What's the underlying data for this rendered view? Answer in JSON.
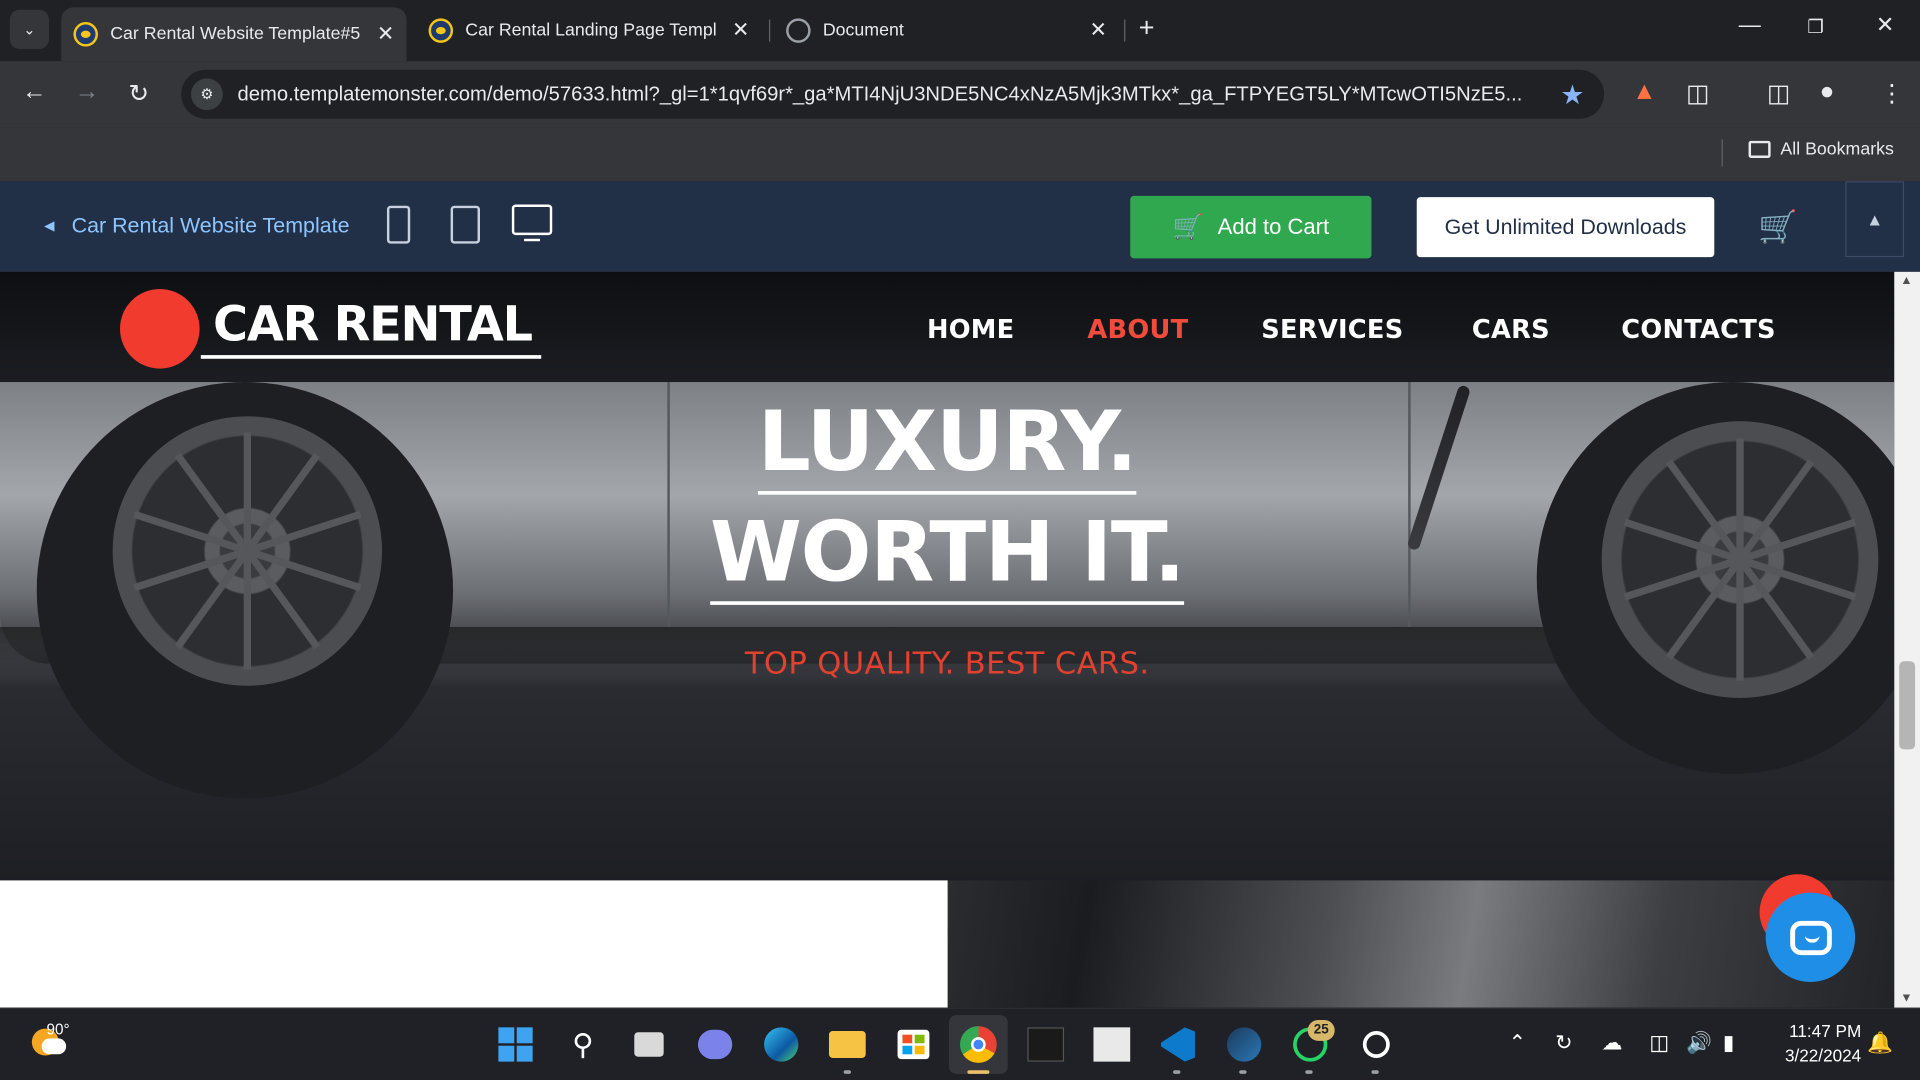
{
  "browser": {
    "tabs": [
      {
        "title": "Car Rental Website Template#5",
        "active": true
      },
      {
        "title": "Car Rental Landing Page Templ",
        "active": false
      },
      {
        "title": "Document",
        "active": false
      }
    ],
    "url": "demo.templatemonster.com/demo/57633.html?_gl=1*1qvf69r*_ga*MTI4NjU3NDE5NC4xNzA5Mjk3MTkx*_ga_FTPYEGT5LY*MTcwOTI5NzE5...",
    "bookmarks_label": "All Bookmarks"
  },
  "demobar": {
    "back_label": "Car Rental Website Template",
    "add_to_cart_label": "Add to Cart",
    "unlimited_label": "Get Unlimited Downloads",
    "accent_color": "#2fa84f"
  },
  "site": {
    "logo_text": "CAR RENTAL",
    "nav": [
      {
        "label": "HOME",
        "active": false
      },
      {
        "label": "ABOUT",
        "active": true
      },
      {
        "label": "SERVICES",
        "active": false
      },
      {
        "label": "CARS",
        "active": false
      },
      {
        "label": "CONTACTS",
        "active": false
      }
    ],
    "hero_line1": "LUXURY.",
    "hero_line2": "WORTH IT.",
    "hero_sub": "TOP QUALITY. BEST CARS.",
    "brand_color": "#f23b2f"
  },
  "taskbar": {
    "weather_temp": "90°",
    "whatsapp_badge": "25",
    "time": "11:47 PM",
    "date": "3/22/2024"
  }
}
